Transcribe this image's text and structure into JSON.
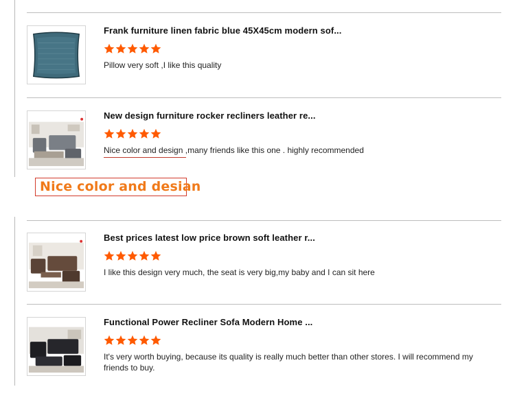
{
  "colors": {
    "star": "#ff5a00",
    "callout_text": "#f07a1a",
    "callout_border": "#d23a2a",
    "divider": "#bdbdbd"
  },
  "callout": {
    "text": "Nice color and desian"
  },
  "reviews": [
    {
      "title": "Frank furniture linen fabric blue 45X45cm modern sof...",
      "rating": 5,
      "comment": "Pillow very soft ,I like this quality",
      "image_icon": "pillow-thumbnail"
    },
    {
      "title": "New design furniture rocker recliners leather re...",
      "rating": 5,
      "comment": "Nice color and design ,many friends like this one . highly recommended",
      "image_icon": "grey-recliner-sofa-thumbnail"
    },
    {
      "title": "Best prices latest low price brown soft leather r...",
      "rating": 5,
      "comment": "I like this design very much, the seat is very big,my baby and I can sit here",
      "image_icon": "brown-leather-sofa-thumbnail"
    },
    {
      "title": "Functional Power Recliner Sofa Modern Home ...",
      "rating": 5,
      "comment": "It's very worth buying, because its quality is really much better than other stores. I will recommend my friends to buy.",
      "image_icon": "black-recliner-sofa-thumbnail"
    }
  ]
}
